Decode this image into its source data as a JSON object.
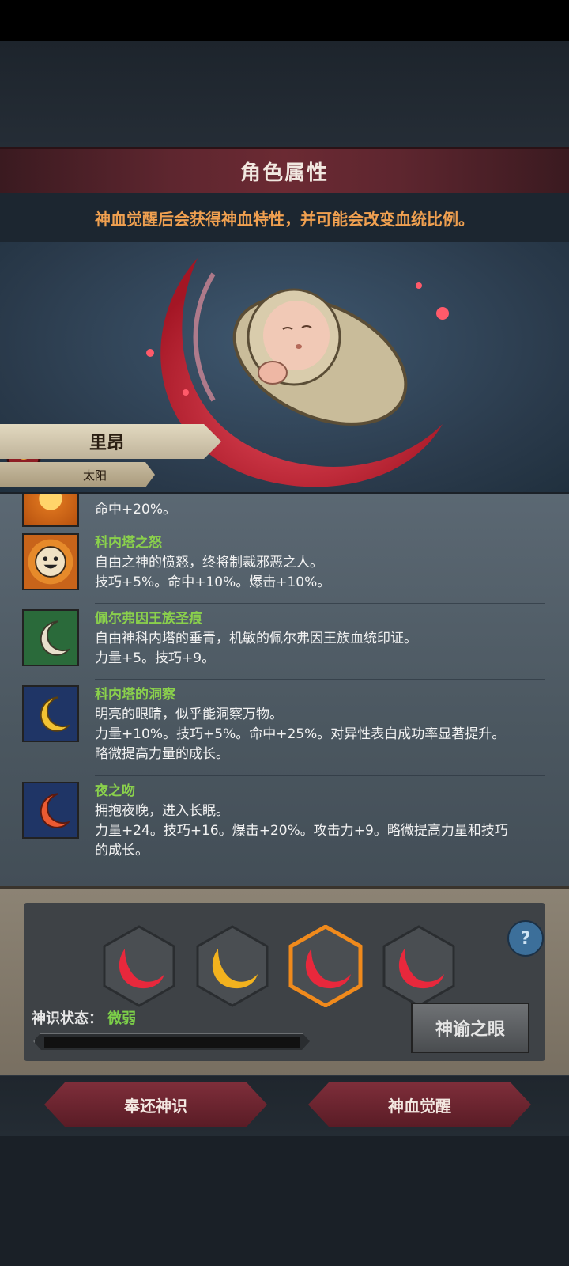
{
  "header": {
    "title": "角色属性",
    "notice": "神血觉醒后会获得神血特性，并可能会改变血统比例。"
  },
  "character": {
    "name": "里昂",
    "subtitle": "太阳"
  },
  "traits": [
    {
      "name": "",
      "desc": "",
      "stats": "命中+20%。",
      "icon": "sun-face-icon"
    },
    {
      "name": "科内塔之怒",
      "desc": "自由之神的愤怒，终将制裁邪恶之人。",
      "stats": "技巧+5%。命中+10%。爆击+10%。",
      "icon": "sun-face-icon"
    },
    {
      "name": "佩尔弗因王族圣痕",
      "desc": "自由神科内塔的垂青，机敏的佩尔弗因王族血统印证。",
      "stats": "力量+5。技巧+9。",
      "icon": "white-crescent-icon"
    },
    {
      "name": "科内塔的洞察",
      "desc": "明亮的眼睛，似乎能洞察万物。",
      "stats": "力量+10%。技巧+5%。命中+25%。对异性表白成功率显著提升。",
      "extra": "略微提高力量的成长。",
      "icon": "gold-crescent-icon"
    },
    {
      "name": "夜之吻",
      "desc": "拥抱夜晚，进入长眠。",
      "stats": "力量+24。技巧+16。爆击+20%。攻击力+9。略微提高力量和技巧",
      "extra": "的成长。",
      "icon": "red-crescent-icon"
    }
  ],
  "panel": {
    "status_label": "神识状态：",
    "status_value": "微弱",
    "eye_button": "神谕之眼",
    "help": "?",
    "slots": [
      "red-crescent-slot",
      "gold-crescent-slot",
      "red-crescent-slot-selected",
      "red-crescent-slot"
    ]
  },
  "actions": {
    "return": "奉还神识",
    "awaken": "神血觉醒"
  },
  "colors": {
    "accent_orange": "#f0a050",
    "trait_name_green": "#8ad04c",
    "blood_red": "#e8283c"
  }
}
